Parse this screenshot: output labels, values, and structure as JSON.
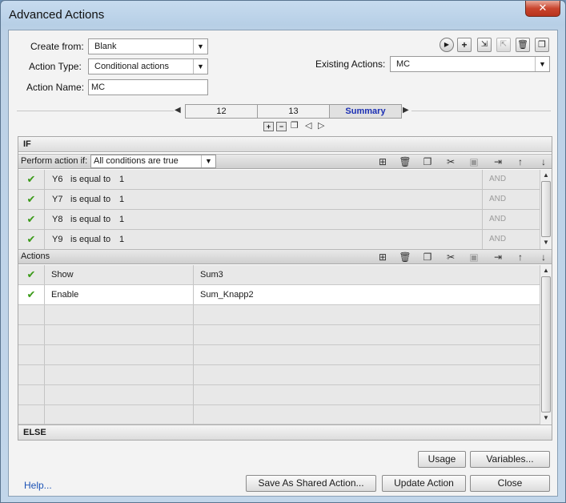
{
  "window": {
    "title": "Advanced Actions",
    "close_glyph": "✕"
  },
  "form": {
    "create_from_label": "Create from:",
    "create_from_value": "Blank",
    "action_type_label": "Action Type:",
    "action_type_value": "Conditional actions",
    "action_name_label": "Action Name:",
    "action_name_value": "MC",
    "existing_actions_label": "Existing Actions:",
    "existing_actions_value": "MC"
  },
  "toolbar_icons": [
    "play-preview-icon",
    "add-icon",
    "import-icon",
    "export-icon",
    "delete-icon",
    "duplicate-icon"
  ],
  "tabs": [
    {
      "label": "12",
      "active": false
    },
    {
      "label": "13",
      "active": false
    },
    {
      "label": "Summary",
      "active": true
    }
  ],
  "if_section": {
    "header": "IF",
    "perform_label": "Perform action if:",
    "perform_value": "All conditions are true",
    "conditions": [
      {
        "var": "Y6",
        "op": "is equal to",
        "val": "1",
        "logic": "AND"
      },
      {
        "var": "Y7",
        "op": "is equal to",
        "val": "1",
        "logic": "AND"
      },
      {
        "var": "Y8",
        "op": "is equal to",
        "val": "1",
        "logic": "AND"
      },
      {
        "var": "Y9",
        "op": "is equal to",
        "val": "1",
        "logic": "AND"
      }
    ]
  },
  "actions_section": {
    "header": "Actions",
    "rows": [
      {
        "action": "Show",
        "target": "Sum3"
      },
      {
        "action": "Enable",
        "target": "Sum_Knapp2"
      }
    ]
  },
  "else_section": {
    "header": "ELSE"
  },
  "buttons": {
    "usage": "Usage",
    "variables": "Variables...",
    "save_shared": "Save As Shared Action...",
    "update": "Update Action",
    "close": "Close",
    "help": "Help..."
  },
  "colors": {
    "accent_tab": "#1b2fb4",
    "check": "#3a9a18",
    "link": "#1c53b6"
  }
}
